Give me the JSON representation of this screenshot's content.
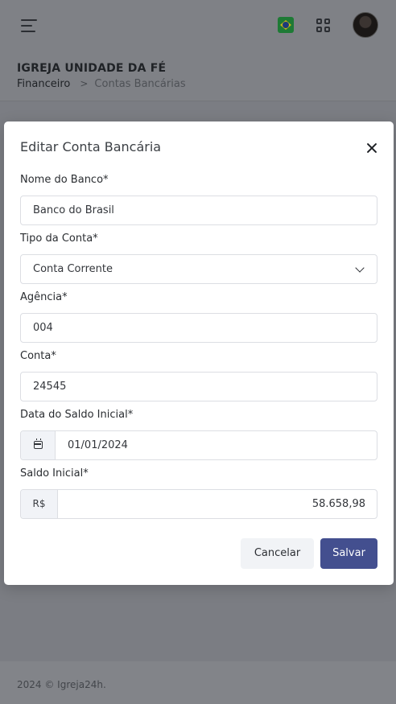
{
  "header": {
    "menu_icon": "hamburger-menu-icon",
    "flag_icon": "brazil-flag-icon",
    "apps_icon": "apps-grid-icon",
    "avatar_icon": "user-avatar"
  },
  "page": {
    "title": "IGREJA UNIDADE DA FÉ",
    "breadcrumb": [
      "Financeiro",
      "Contas Bancárias"
    ],
    "breadcrumb_separator": ">"
  },
  "modal": {
    "title": "Editar Conta Bancária",
    "close_icon": "close-icon",
    "fields": {
      "bank_name": {
        "label": "Nome do Banco*",
        "value": "Banco do Brasil"
      },
      "account_type": {
        "label": "Tipo da Conta*",
        "value": "Conta Corrente"
      },
      "agency": {
        "label": "Agência*",
        "value": "004"
      },
      "account": {
        "label": "Conta*",
        "value": "24545"
      },
      "initial_balance_date": {
        "label": "Data do Saldo Inicial*",
        "value": "01/01/2024",
        "icon": "calendar-icon"
      },
      "initial_balance": {
        "label": "Saldo Inicial*",
        "prefix": "R$",
        "value": "58.658,98"
      }
    },
    "buttons": {
      "cancel": "Cancelar",
      "save": "Salvar"
    }
  },
  "footer": {
    "text": "2024 © Igreja24h."
  },
  "colors": {
    "primary": "#434f8f",
    "overlay": "#7b7d83",
    "addon_bg": "#f1f3f7"
  }
}
